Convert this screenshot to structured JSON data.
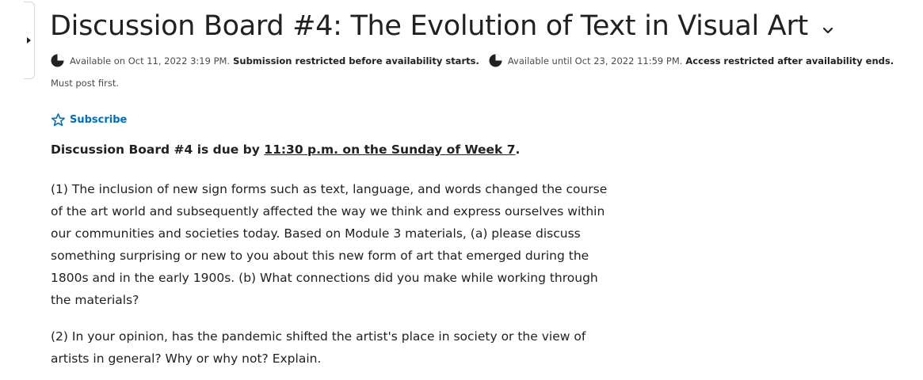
{
  "header": {
    "title": "Discussion Board #4: The Evolution of Text in Visual Art"
  },
  "availability": {
    "start_text": "Available on Oct 11, 2022 3:19 PM.",
    "start_restriction": "Submission restricted before availability starts.",
    "end_text": "Available until Oct 23, 2022 11:59 PM.",
    "end_restriction": "Access restricted after availability ends.",
    "must_post": "Must post first."
  },
  "subscribe": {
    "label": "Subscribe"
  },
  "due": {
    "prefix": "Discussion Board #4 is due by ",
    "link_text": "11:30 p.m. on the Sunday of Week 7",
    "suffix": "."
  },
  "body": {
    "paragraph1": "(1) The inclusion of new sign forms such as text, language, and words changed the course of the art world and subsequently affected the way we think and express ourselves within our communities and societies today. Based on Module 3 materials, (a) please discuss something surprising or new to you about this new form of art that emerged during the 1800s and in the early 1900s. (b) What connections did you make while working through the materials?",
    "paragraph2": "(2) In your opinion, has the pandemic shifted the artist's place in society or the view of artists in general? Why or why not? Explain."
  },
  "colors": {
    "link_blue": "#006fbf",
    "text": "#202122",
    "border": "#d3d9e3"
  },
  "icons": {
    "side_toggle": "triangle-right-icon",
    "title_menu": "chevron-down-icon",
    "availability": "clock-icon",
    "subscribe": "star-outline-icon"
  }
}
